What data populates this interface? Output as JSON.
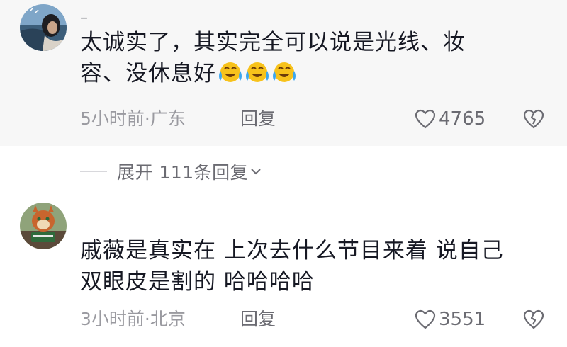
{
  "comments": [
    {
      "username": "–",
      "text_line1": "太诚实了，其实完全可以说是光线、妆",
      "text_line2": "容、没休息好",
      "emoji_count": 3,
      "emoji": "crying-laughing-face",
      "time_location": "5小时前·广东",
      "reply_label": "回复",
      "likes": "4765"
    },
    {
      "text_line1": "戚薇是真实在 上次去什么节目来着 说自己",
      "text_line2": "双眼皮是割的 哈哈哈哈",
      "time_location": "3小时前·北京",
      "reply_label": "回复",
      "likes": "3551"
    }
  ],
  "expand_replies": "展开 111条回复",
  "colors": {
    "accent_emoji": "#f7c21b",
    "tear": "#3da7f0",
    "muted": "#9a9aa0"
  }
}
